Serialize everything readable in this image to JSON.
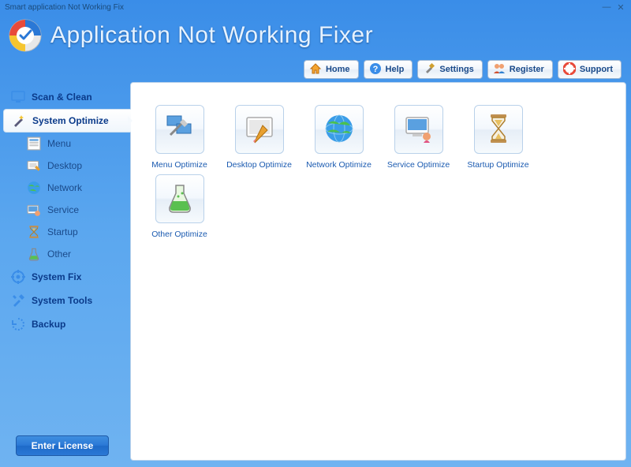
{
  "window": {
    "title": "Smart application Not Working Fix"
  },
  "header": {
    "app_title": "Application Not Working Fixer"
  },
  "toolbar": {
    "home": "Home",
    "help": "Help",
    "settings": "Settings",
    "register": "Register",
    "support": "Support"
  },
  "sidebar": {
    "scan_clean": "Scan & Clean",
    "system_optimize": "System Optimize",
    "sub": {
      "menu": "Menu",
      "desktop": "Desktop",
      "network": "Network",
      "service": "Service",
      "startup": "Startup",
      "other": "Other"
    },
    "system_fix": "System Fix",
    "system_tools": "System Tools",
    "backup": "Backup",
    "enter_license": "Enter License"
  },
  "optimize_items": {
    "menu": "Menu Optimize",
    "desktop": "Desktop Optimize",
    "network": "Network Optimize",
    "service": "Service Optimize",
    "startup": "Startup Optimize",
    "other": "Other Optimize"
  }
}
